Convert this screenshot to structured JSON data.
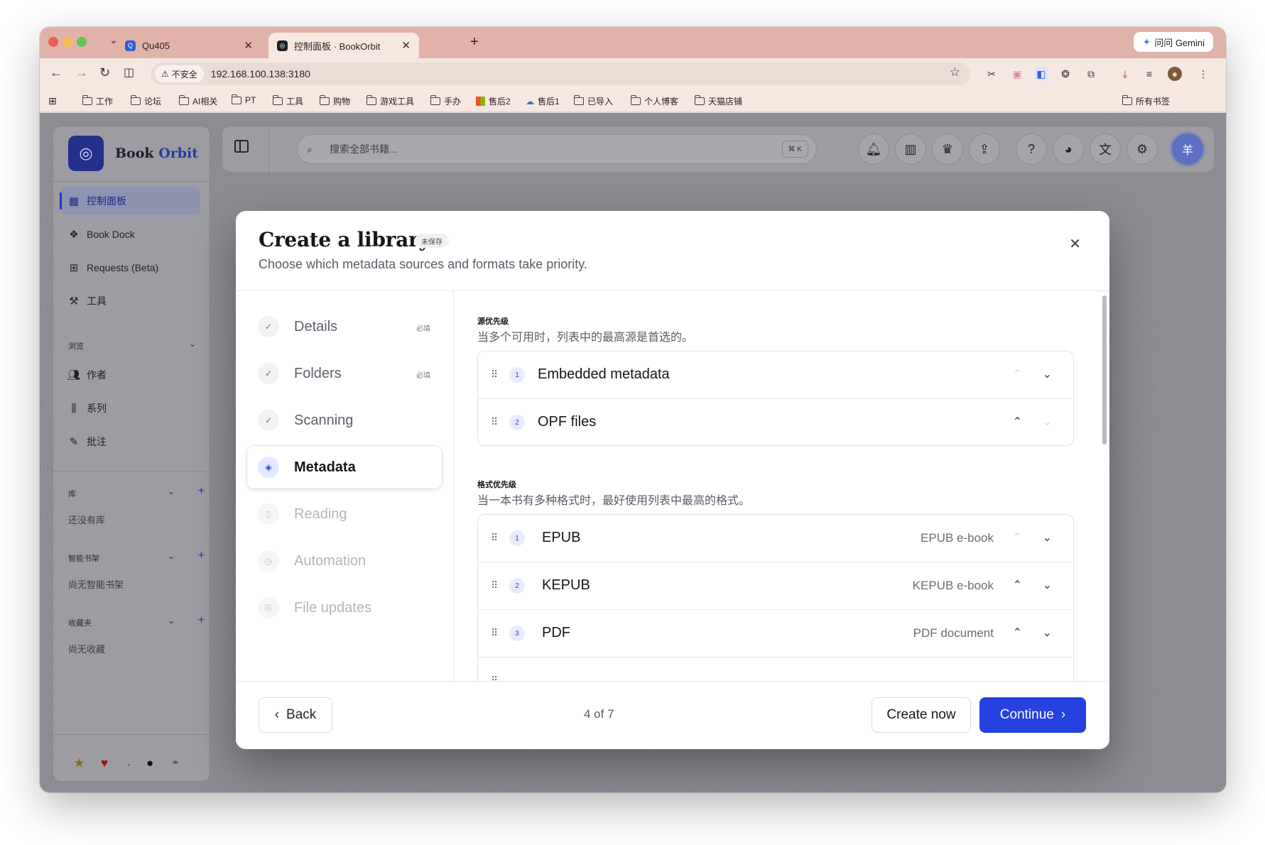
{
  "browser": {
    "tabs": [
      {
        "title": "Qu405",
        "active": false
      },
      {
        "title": "控制面板 · BookOrbit",
        "active": true
      }
    ],
    "gemini_label": "问问 Gemini",
    "insecure_label": "不安全",
    "url": "192.168.100.138:3180",
    "bookmarks": [
      "工作",
      "论坛",
      "AI相关",
      "PT",
      "工具",
      "购物",
      "游戏工具",
      "手办",
      "售后2",
      "售后1",
      "已导入",
      "个人博客",
      "天猫店铺"
    ],
    "all_bookmarks": "所有书签"
  },
  "app": {
    "brand_primary": "Book",
    "brand_secondary": "Orbit",
    "nav": [
      {
        "label": "控制面板",
        "icon": "dashboard-icon",
        "active": true
      },
      {
        "label": "Book Dock",
        "icon": "dock-icon",
        "active": false
      },
      {
        "label": "Requests (Beta)",
        "icon": "request-icon",
        "active": false
      },
      {
        "label": "工具",
        "icon": "wrench-icon",
        "active": false
      }
    ],
    "browse_section": "浏览",
    "browse": [
      {
        "label": "作者",
        "icon": "authors-icon"
      },
      {
        "label": "系列",
        "icon": "series-icon"
      },
      {
        "label": "批注",
        "icon": "annotations-icon"
      }
    ],
    "library_section": "库",
    "library_empty": "还没有库",
    "shelves_section": "智能书架",
    "shelves_empty": "尚无智能书架",
    "favorites_section": "收藏夹",
    "favorites_empty": "尚无收藏",
    "search_placeholder": "搜索全部书籍...",
    "search_shortcut": "⌘ K",
    "avatar_initial": "羊"
  },
  "modal": {
    "title": "Create a library",
    "badge": "未保存",
    "subtitle": "Choose which metadata sources and formats take priority.",
    "steps": [
      {
        "label": "Details",
        "state": "done",
        "required": "必填"
      },
      {
        "label": "Folders",
        "state": "done",
        "required": "必填"
      },
      {
        "label": "Scanning",
        "state": "done",
        "required": ""
      },
      {
        "label": "Metadata",
        "state": "current",
        "required": ""
      },
      {
        "label": "Reading",
        "state": "pending",
        "required": ""
      },
      {
        "label": "Automation",
        "state": "pending",
        "required": ""
      },
      {
        "label": "File updates",
        "state": "pending",
        "required": ""
      }
    ],
    "source_priority": {
      "title": "源优先级",
      "description": "当多个可用时，列表中的最高源是首选的。",
      "items": [
        {
          "rank": "1",
          "name": "Embedded metadata"
        },
        {
          "rank": "2",
          "name": "OPF files"
        }
      ]
    },
    "format_priority": {
      "title": "格式优先级",
      "description": "当一本书有多种格式时，最好使用列表中最高的格式。",
      "items": [
        {
          "rank": "1",
          "name": "EPUB",
          "description": "EPUB e-book"
        },
        {
          "rank": "2",
          "name": "KEPUB",
          "description": "KEPUB e-book"
        },
        {
          "rank": "3",
          "name": "PDF",
          "description": "PDF document"
        }
      ]
    },
    "footer": {
      "back": "Back",
      "step_count": "4 of 7",
      "create_now": "Create now",
      "continue": "Continue"
    }
  }
}
